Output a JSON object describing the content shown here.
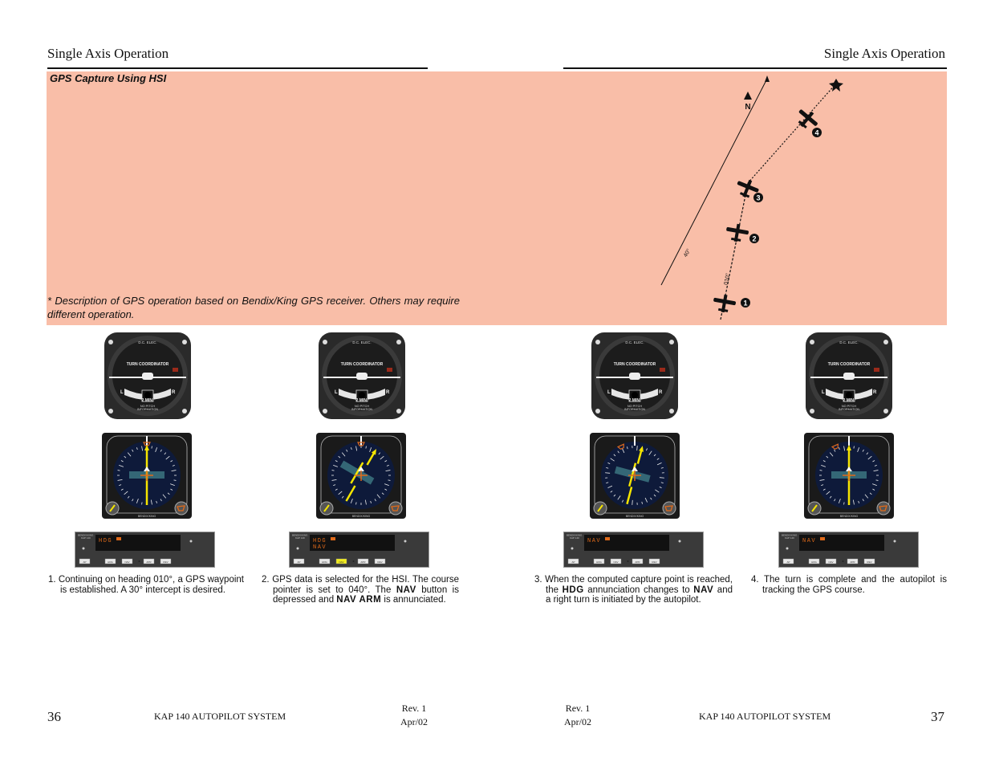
{
  "left_page": {
    "title": "Single Axis Operation",
    "page_number": "36",
    "footer_system": "KAP 140 AUTOPILOT SYSTEM",
    "revision": "Rev. 1",
    "date": "Apr/02"
  },
  "right_page": {
    "title": "Single Axis Operation",
    "page_number": "37",
    "footer_system": "KAP 140 AUTOPILOT SYSTEM",
    "revision": "Rev. 1",
    "date": "Apr/02"
  },
  "section": {
    "heading": "GPS Capture Using HSI",
    "note": "* Description of GPS operation based on Bendix/King GPS receiver. Others may require different operation."
  },
  "diagram": {
    "north_label": "N",
    "course_label": "40°",
    "heading_label": "010°",
    "positions": [
      "1",
      "2",
      "3",
      "4"
    ]
  },
  "turn_coordinator": {
    "top_label": "D.C. ELEC.",
    "title": "TURN COORDINATOR",
    "left": "L",
    "right": "R",
    "rate": "2 MIN.",
    "note_line1": "NO PITCH",
    "note_line2": "INFORMATION"
  },
  "hsi": {
    "brand": "BENDIX/KING"
  },
  "autopilot": {
    "brand_line1": "BENDIX/KING",
    "brand_line2": "KAP 140",
    "buttons": [
      "AP",
      "HDG",
      "NAV",
      "APR",
      "REV"
    ],
    "steps": [
      {
        "line1": "HDG",
        "line1_badge": "AP",
        "line2": "",
        "highlight": ""
      },
      {
        "line1": "HDG",
        "line1_badge": "AP",
        "line2": "NAV",
        "highlight": "NAV"
      },
      {
        "line1": "NAV",
        "line1_badge": "AP",
        "line2": "",
        "highlight": ""
      },
      {
        "line1": "NAV",
        "line1_badge": "AP",
        "line2": "",
        "highlight": ""
      }
    ]
  },
  "captions": [
    {
      "num": "1.",
      "parts": [
        "Continuing on heading 010°, a GPS waypoint is established. A 30° intercept is desired."
      ]
    },
    {
      "num": "2.",
      "p1": "GPS data is selected for the HSI. The course pointer is set to 040°. The ",
      "b1": "NAV",
      "p2": " button is depressed and ",
      "b2": "NAV ARM",
      "p3": " is annunciated."
    },
    {
      "num": "3.",
      "p1": "When the computed capture point is reached, the ",
      "b1": "HDG",
      "p2": " annunciation changes to ",
      "b2": "NAV",
      "p3": " and a right turn is initiated by  the autopilot."
    },
    {
      "num": "4.",
      "parts": [
        "The turn is complete and the autopilot is tracking the GPS course."
      ]
    }
  ],
  "colors": {
    "band": "#f9bea8",
    "needle": "#f5e500",
    "annunciator": "#e06a1a",
    "hsi_face": "#0e1a3a"
  }
}
